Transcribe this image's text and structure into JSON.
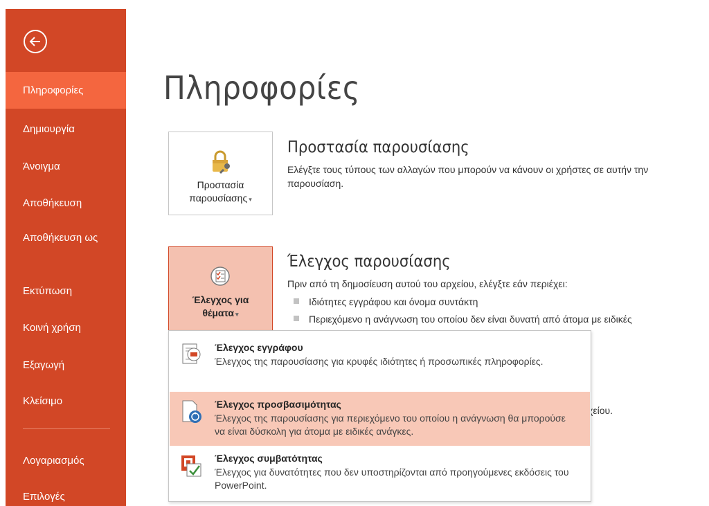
{
  "sidebar": {
    "items": [
      {
        "label": "Πληροφορίες",
        "active": true
      },
      {
        "label": "Δημιουργία"
      },
      {
        "label": "Άνοιγμα"
      },
      {
        "label": "Αποθήκευση"
      },
      {
        "label": "Αποθήκευση ως"
      },
      {
        "label": "Εκτύπωση"
      },
      {
        "label": "Κοινή χρήση"
      },
      {
        "label": "Εξαγωγή"
      },
      {
        "label": "Κλείσιμο"
      },
      {
        "label": "Λογαριασμός"
      },
      {
        "label": "Επιλογές"
      }
    ],
    "back_icon": "back-arrow-icon",
    "accent": "#d24726",
    "active_color": "#f4663f"
  },
  "page": {
    "title": "Πληροφορίες"
  },
  "protect": {
    "tile_line1": "Προστασία",
    "tile_line2": "παρουσίασης",
    "title": "Προστασία παρουσίασης",
    "desc": "Ελέγξτε τους τύπους των αλλαγών που μπορούν να κάνουν οι χρήστες σε αυτήν την παρουσίαση.",
    "icon": "lock-key-icon"
  },
  "inspect": {
    "tile_line1": "Έλεγχος για",
    "tile_line2": "θέματα",
    "title": "Έλεγχος παρουσίασης",
    "desc": "Πριν από τη δημοσίευση αυτού του αρχείου, ελέγξτε εάν περιέχει:",
    "bullets": [
      "Ιδιότητες εγγράφου και όνομα συντάκτη",
      "Περιεχόμενο η ανάγνωση του οποίου δεν είναι δυνατή από άτομα με ειδικές"
    ],
    "peek_text": "χείου.",
    "icon": "checklist-icon"
  },
  "menu": {
    "items": [
      {
        "title": "Έλεγχος εγγράφου",
        "desc": "Έλεγχος της παρουσίασης για κρυφές ιδιότητες ή προσωπικές πληροφορίες.",
        "icon": "inspect-document-icon"
      },
      {
        "title": "Έλεγχος προσβασιμότητας",
        "desc": "Έλεγχος της παρουσίασης για περιεχόμενο του οποίου η ανάγνωση θα μπορούσε να είναι δύσκολη για άτομα με ειδικές ανάγκες.",
        "icon": "accessibility-check-icon",
        "highlighted": true
      },
      {
        "title": "Έλεγχος συμβατότητας",
        "desc": "Έλεγχος για δυνατότητες που δεν υποστηρίζονται από προηγούμενες εκδόσεις του PowerPoint.",
        "icon": "compatibility-check-icon"
      }
    ]
  }
}
